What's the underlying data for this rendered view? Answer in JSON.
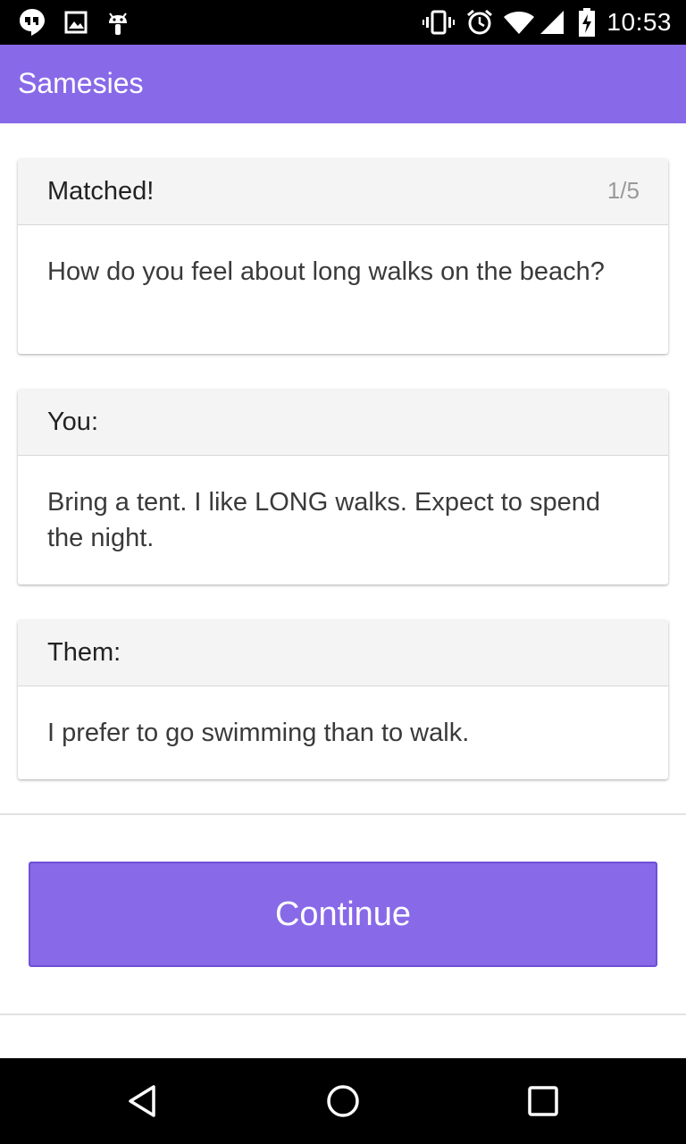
{
  "status_bar": {
    "time": "10:53",
    "left_icons": [
      "hangouts-icon",
      "image-icon",
      "android-debug-icon"
    ],
    "right_icons": [
      "vibrate-icon",
      "alarm-icon",
      "wifi-icon",
      "signal-icon",
      "battery-charging-icon"
    ]
  },
  "app_bar": {
    "title": "Samesies"
  },
  "cards": {
    "question": {
      "header": "Matched!",
      "counter": "1/5",
      "body": "How do you feel about long walks on the beach?"
    },
    "you": {
      "header": "You:",
      "body": "Bring a tent. I like LONG walks. Expect to spend the night."
    },
    "them": {
      "header": "Them:",
      "body": "I prefer to go swimming than to walk."
    }
  },
  "continue_button": {
    "label": "Continue"
  },
  "nav_bar": {
    "icons": [
      "back-icon",
      "home-icon",
      "recents-icon"
    ]
  },
  "colors": {
    "accent": "#8869e8",
    "status_bar": "#000000",
    "nav_bar": "#000000"
  }
}
